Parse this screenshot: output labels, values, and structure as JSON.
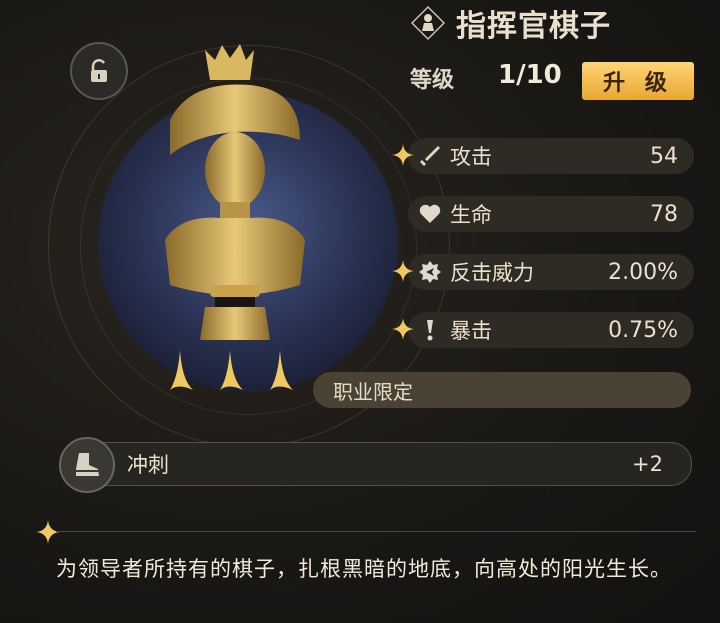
{
  "item": {
    "title": "指挥官棋子",
    "level_label": "等级",
    "level_value": "1/10",
    "upgrade_label": "升 级",
    "star_count": 3
  },
  "stats": [
    {
      "name": "攻击",
      "value": "54",
      "icon": "sword-icon"
    },
    {
      "name": "生命",
      "value": "78",
      "icon": "heart-icon"
    },
    {
      "name": "反击威力",
      "value": "2.00%",
      "icon": "counter-icon"
    },
    {
      "name": "暴击",
      "value": "0.75%",
      "icon": "crit-icon"
    }
  ],
  "job_restriction": "职业限定",
  "skill": {
    "name": "冲刺",
    "value": "+2",
    "icon": "boot-icon"
  },
  "description": "为领导者所持有的棋子，扎根黑暗的地底，向高处的阳光生长。",
  "colors": {
    "accent": "#ffd577",
    "gold": "#c9a24a",
    "panel": "#2e2b25"
  }
}
